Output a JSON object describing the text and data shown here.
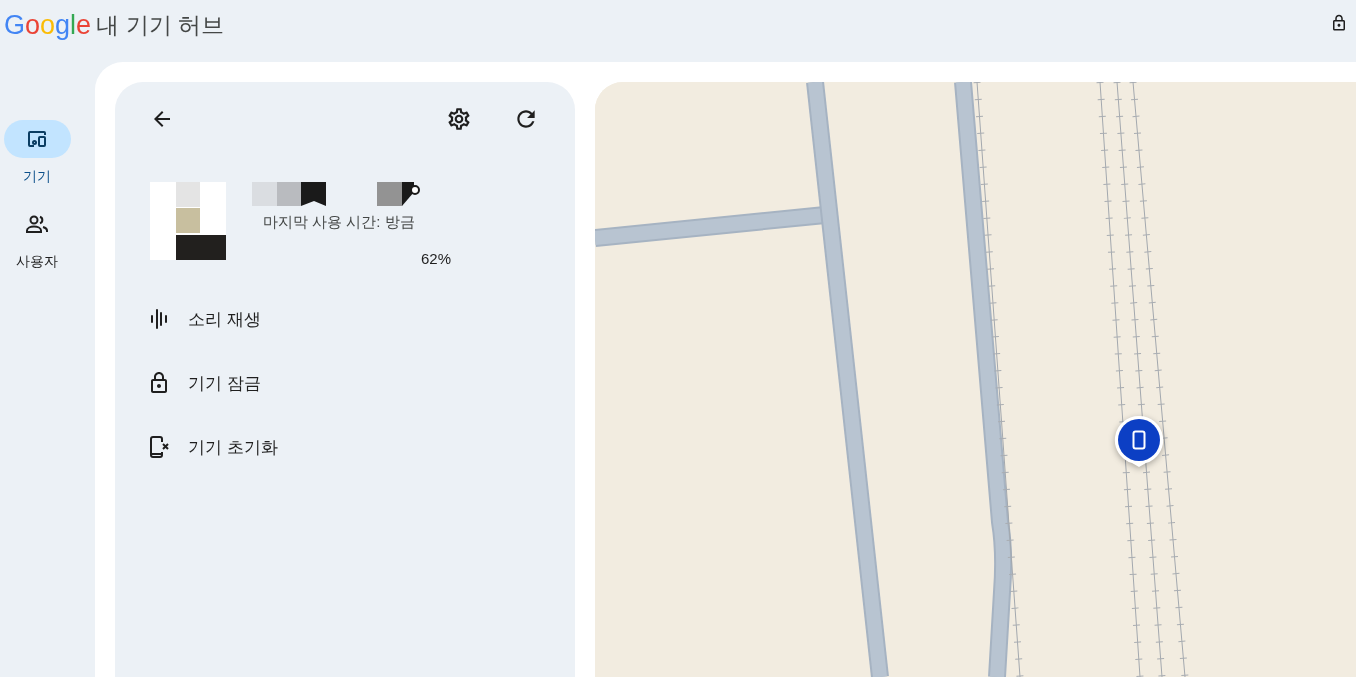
{
  "header": {
    "logo": "Google",
    "title": "내 기기 허브"
  },
  "nav": {
    "items": [
      {
        "label": "기기",
        "selected": true
      },
      {
        "label": "사용자",
        "selected": false
      }
    ]
  },
  "device": {
    "last_used": "마지막 사용 시간: 방금",
    "battery": "62%"
  },
  "actions": [
    {
      "label": "소리 재생"
    },
    {
      "label": "기기 잠금"
    },
    {
      "label": "기기 초기화"
    }
  ]
}
